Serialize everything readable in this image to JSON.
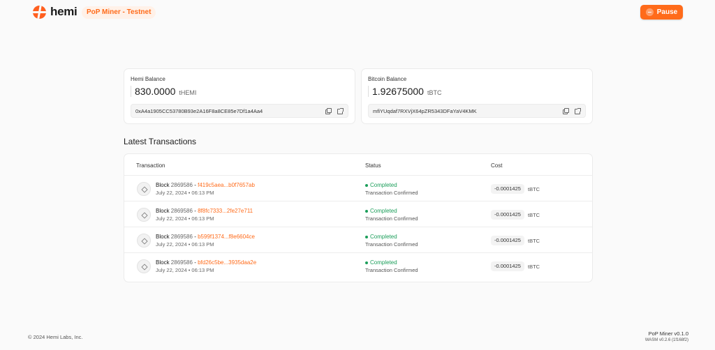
{
  "header": {
    "logo_text": "hemi",
    "env_badge": "PoP Miner - Testnet",
    "pause_label": "Pause"
  },
  "balances": {
    "hemi": {
      "title": "Hemi Balance",
      "amount": "830.0000",
      "unit": "tHEMI",
      "address": "0xA4a1905CC53780B93e2A16F8a8CE85e7Df1a4Aa4"
    },
    "bitcoin": {
      "title": "Bitcoin Balance",
      "amount": "1.92675000",
      "unit": "tBTC",
      "address": "mfiYUqdaf7RXVjX64pZR5343DFaYaV4KMK"
    }
  },
  "transactions": {
    "heading": "Latest Transactions",
    "columns": {
      "transaction": "Transaction",
      "status": "Status",
      "cost": "Cost"
    },
    "rows": [
      {
        "block_label": "Block",
        "block_num": "2869586",
        "sep": "-",
        "hash": "f419c5aea...b0f7657ab",
        "date": "July 22, 2024 • 06:13 PM",
        "status": "Completed",
        "status_sub": "Transaction Confirmed",
        "cost": "-0.0001425",
        "cost_unit": "tBTC"
      },
      {
        "block_label": "Block",
        "block_num": "2869586",
        "sep": "-",
        "hash": "8f8fc7333...2fe27e711",
        "date": "July 22, 2024 • 06:13 PM",
        "status": "Completed",
        "status_sub": "Transaction Confirmed",
        "cost": "-0.0001425",
        "cost_unit": "tBTC"
      },
      {
        "block_label": "Block",
        "block_num": "2869586",
        "sep": "-",
        "hash": "b599f1374...f8e6604ce",
        "date": "July 22, 2024 • 06:13 PM",
        "status": "Completed",
        "status_sub": "Transaction Confirmed",
        "cost": "-0.0001425",
        "cost_unit": "tBTC"
      },
      {
        "block_label": "Block",
        "block_num": "2869586",
        "sep": "-",
        "hash": "bfd26c5be...3935daa2e",
        "date": "July 22, 2024 • 06:13 PM",
        "status": "Completed",
        "status_sub": "Transaction Confirmed",
        "cost": "-0.0001425",
        "cost_unit": "tBTC"
      }
    ]
  },
  "footer": {
    "copyright": "© 2024 Hemi Labs, Inc.",
    "version": "PoP Miner v0.1.0",
    "wasm": "WASM v0.2.6 (1f168f2)"
  },
  "colors": {
    "accent": "#ff6b1a",
    "success": "#1b9e5a"
  }
}
